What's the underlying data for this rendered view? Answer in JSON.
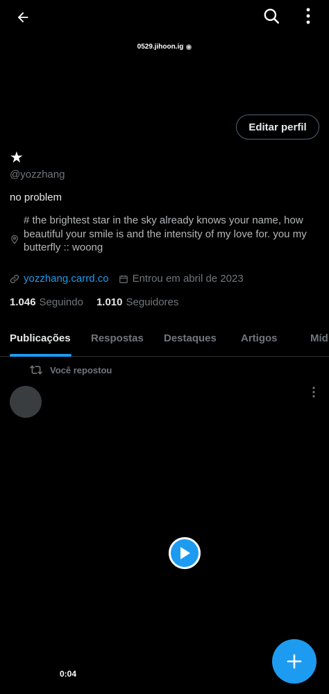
{
  "header": {
    "banner_label": "0529.jihoon.ig",
    "edit_button": "Editar perfil"
  },
  "profile": {
    "display_name": "★",
    "handle": "@yozzhang",
    "bio": "no problem",
    "location": "#  the brightest star in the sky already knows your name, how beautiful your smile is and the intensity of my love for. you my butterfly :: woong",
    "website": "yozzhang.carrd.co",
    "joined": "Entrou em abril de 2023",
    "following_count": "1.046",
    "following_label": "Seguindo",
    "followers_count": "1.010",
    "followers_label": "Seguidores"
  },
  "tabs": [
    "Publicações",
    "Respostas",
    "Destaques",
    "Artigos",
    "Míd"
  ],
  "feed": {
    "repost_label": "Você repostou",
    "video_duration": "0:04"
  },
  "colors": {
    "accent": "#1d9bf0",
    "background": "#000000",
    "muted_text": "#71767b"
  },
  "icons": [
    "back-arrow-icon",
    "search-icon",
    "more-vertical-icon",
    "verified-icon",
    "location-pin-icon",
    "link-icon",
    "calendar-icon",
    "repost-icon",
    "play-icon",
    "plus-icon"
  ]
}
